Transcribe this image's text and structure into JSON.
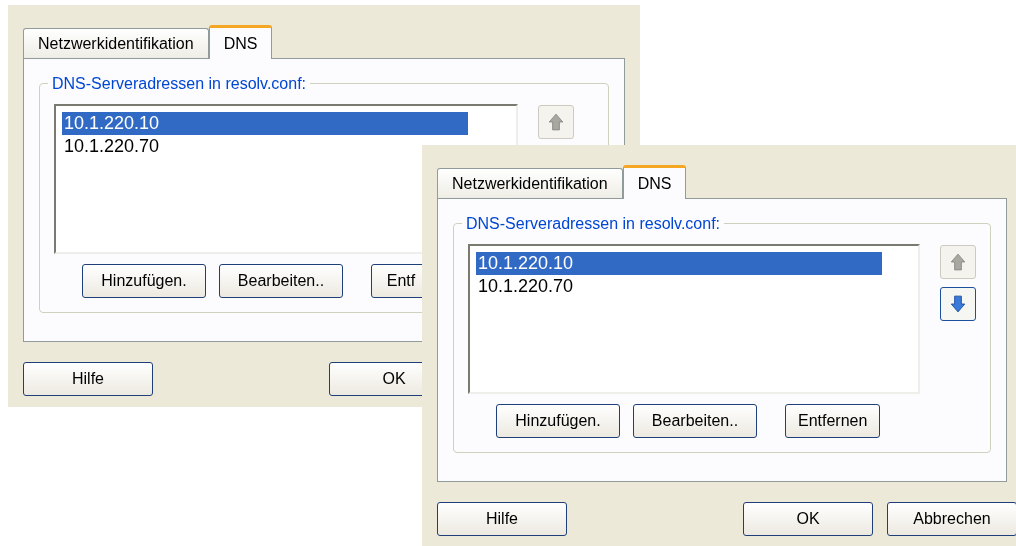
{
  "dialogs": [
    {
      "tabs": [
        {
          "label": "Netzwerkidentifikation",
          "selected": false
        },
        {
          "label": "DNS",
          "selected": true
        }
      ],
      "group_label": "DNS-Serveradressen in resolv.conf:",
      "servers": [
        {
          "address": "10.1.220.10",
          "selected": true
        },
        {
          "address": "10.1.220.70",
          "selected": false
        }
      ],
      "move_buttons": [
        {
          "kind": "up",
          "disabled": true
        }
      ],
      "list_buttons": [
        "Hinzufügen.",
        "Bearbeiten..",
        "Entf"
      ],
      "dialog_buttons": [
        "Hilfe",
        "OK"
      ]
    },
    {
      "tabs": [
        {
          "label": "Netzwerkidentifikation",
          "selected": false
        },
        {
          "label": "DNS",
          "selected": true
        }
      ],
      "group_label": "DNS-Serveradressen in resolv.conf:",
      "servers": [
        {
          "address": "10.1.220.10",
          "selected": true
        },
        {
          "address": "10.1.220.70",
          "selected": false
        }
      ],
      "move_buttons": [
        {
          "kind": "up",
          "disabled": true
        },
        {
          "kind": "down",
          "disabled": false
        }
      ],
      "list_buttons": [
        "Hinzufügen.",
        "Bearbeiten..",
        "Entfernen"
      ],
      "dialog_buttons": [
        "Hilfe",
        "OK",
        "Abbrechen"
      ]
    }
  ]
}
